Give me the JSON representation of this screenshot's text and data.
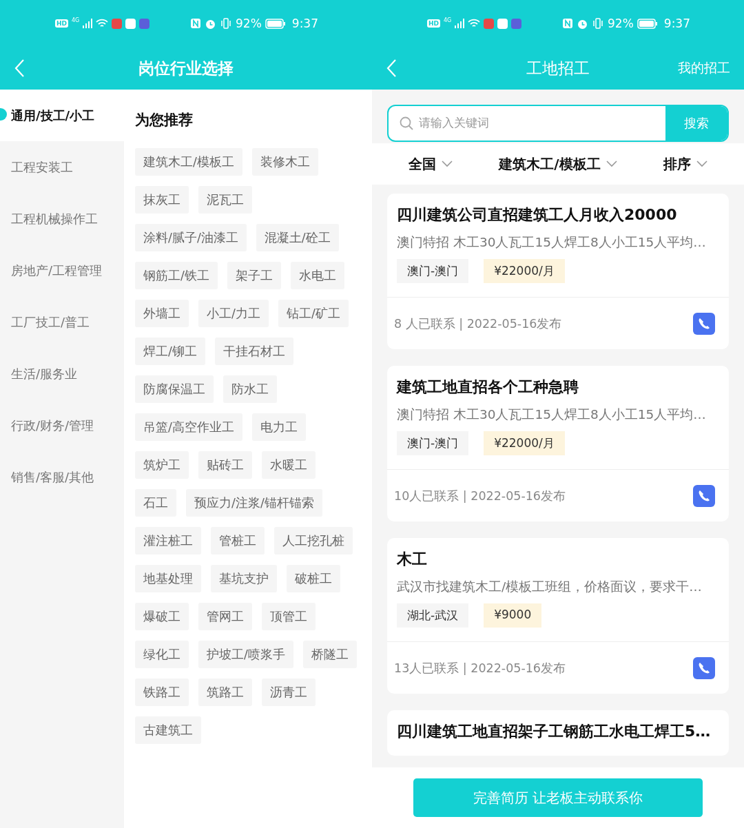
{
  "left_screen": {
    "status_bar": {
      "network_badges": [
        "HD",
        "4G"
      ],
      "battery_text": "92%",
      "time": "9:37"
    },
    "header": {
      "title": "岗位行业选择"
    },
    "sidebar": {
      "items": [
        {
          "label": "通用/技工/小工",
          "selected": true
        },
        {
          "label": "工程安装工",
          "selected": false
        },
        {
          "label": "工程机械操作工",
          "selected": false
        },
        {
          "label": "房地产/工程管理",
          "selected": false
        },
        {
          "label": "工厂技工/普工",
          "selected": false
        },
        {
          "label": "生活/服务业",
          "selected": false
        },
        {
          "label": "行政/财务/管理",
          "selected": false
        },
        {
          "label": "销售/客服/其他",
          "selected": false
        }
      ]
    },
    "recommend": {
      "heading": "为您推荐",
      "tag_rows": [
        [
          "建筑木工/模板工",
          "装修木工"
        ],
        [
          "抹灰工",
          "泥瓦工"
        ],
        [
          "涂料/腻子/油漆工",
          "混凝土/砼工"
        ],
        [
          "钢筋工/铁工",
          "架子工",
          "水电工"
        ],
        [
          "外墙工",
          "小工/力工",
          "钻工/矿工"
        ],
        [
          "焊工/铆工",
          "干挂石材工"
        ],
        [
          "防腐保温工",
          "防水工"
        ],
        [
          "吊篮/高空作业工",
          "电力工"
        ],
        [
          "筑炉工",
          "贴砖工",
          "水暖工"
        ],
        [
          "石工",
          "预应力/注浆/锚杆锚索"
        ],
        [
          "灌注桩工",
          "管桩工",
          "人工挖孔桩"
        ],
        [
          "地基处理",
          "基坑支护",
          "破桩工"
        ],
        [
          "爆破工",
          "管网工",
          "顶管工"
        ],
        [
          "绿化工",
          "护坡工/喷浆手",
          "桥隧工"
        ],
        [
          "铁路工",
          "筑路工",
          "沥青工"
        ],
        [
          "古建筑工"
        ]
      ]
    }
  },
  "right_screen": {
    "status_bar": {
      "network_badges": [
        "HD",
        "4G"
      ],
      "battery_text": "92%",
      "time": "9:37"
    },
    "header": {
      "title": "工地招工",
      "action": "我的招工"
    },
    "search": {
      "placeholder": "请输入关键词",
      "button": "搜索"
    },
    "filters": [
      {
        "label": "全国"
      },
      {
        "label": "建筑木工/模板工"
      },
      {
        "label": "排序"
      }
    ],
    "jobs": [
      {
        "title": "四川建筑公司直招建筑工人月收入20000",
        "description": "澳门特招 木工30人瓦工15人焊工8人小工15人平均…",
        "location": "澳门-澳门",
        "salary": "¥22000/月",
        "footer": "8 人已联系 | 2022-05-16发布"
      },
      {
        "title": "建筑工地直招各个工种急聘",
        "description": "澳门特招 木工30人瓦工15人焊工8人小工15人平均…",
        "location": "澳门-澳门",
        "salary": "¥22000/月",
        "footer": "10人已联系 | 2022-05-16发布"
      },
      {
        "title": "木工",
        "description": "武汉市找建筑木工/模板工班组，价格面议，要求干…",
        "location": "湖北-武汉",
        "salary": "¥9000",
        "footer": "13人已联系 | 2022-05-16发布"
      },
      {
        "title": "四川建筑工地直招架子工钢筋工水电工焊工5…"
      }
    ],
    "bottom_button": "完善简历 让老板主动联系你"
  }
}
